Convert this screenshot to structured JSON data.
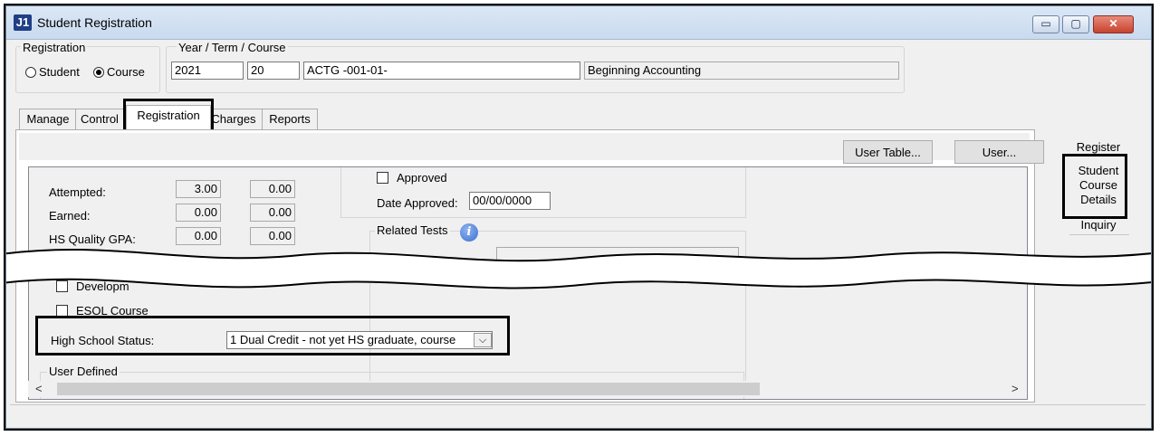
{
  "window": {
    "title": "Student Registration",
    "app_icon": "J1",
    "minimize_glyph": "▭",
    "maximize_glyph": "▢",
    "close_glyph": "✕"
  },
  "registration_group": {
    "label": "Registration",
    "options": [
      "Student",
      "Course"
    ],
    "selected": "Course"
  },
  "ytc_group": {
    "label": "Year / Term / Course",
    "year": "2021",
    "term": "20",
    "course": "ACTG -001-01-",
    "course_title": "Beginning Accounting"
  },
  "tabs": [
    "Manage",
    "Control",
    "Registration",
    "Charges",
    "Reports"
  ],
  "active_tab": "Registration",
  "toolbar": {
    "user_table": "User Table...",
    "user": "User..."
  },
  "fields": {
    "attempted": {
      "label": "Attempted:",
      "v1": "3.00",
      "v2": "0.00"
    },
    "earned": {
      "label": "Earned:",
      "v1": "0.00",
      "v2": "0.00"
    },
    "hs_quality_gpa": {
      "label": "HS Quality GPA:",
      "v1": "0.00",
      "v2": "0.00"
    },
    "approved": "Approved",
    "date_approved_label": "Date Approved:",
    "date_approved": "00/00/0000",
    "related_tests": "Related Tests",
    "developmental": "Developm",
    "esol": "ESOL Course",
    "hs_status_label": "High School Status:",
    "hs_status_value": "1  Dual Credit - not yet HS graduate, course",
    "user_defined": "User Defined"
  },
  "side_panel": {
    "register": "Register",
    "student_course_details": [
      "Student",
      "Course",
      "Details"
    ],
    "inquiry": "Inquiry"
  },
  "icons": {
    "info": "i",
    "combo_arrow": "⌵",
    "scroll_up": "⌃",
    "scroll_down": "⌄",
    "scroll_left": "<",
    "scroll_right": ">"
  }
}
